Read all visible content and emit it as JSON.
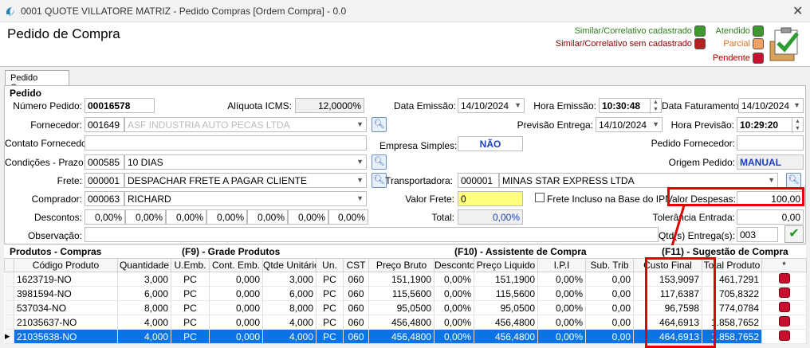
{
  "window": {
    "title": "0001 QUOTE VILLATORE MATRIZ - Pedido Compras [Ordem Compra] - 0.0"
  },
  "page_title": "Pedido de Compra",
  "legend": {
    "similar_cad": "Similar/Correlativo cadastrado",
    "similar_sem": "Similar/Correlativo sem cadastrado",
    "atendido": "Atendido",
    "parcial": "Parcial",
    "pendente": "Pendente",
    "colors": {
      "green": "#3c9a2c",
      "dark_red": "#b22222",
      "orange": "#f0a060",
      "red": "#c8102e"
    }
  },
  "tab": "Pedido Compra",
  "section": "Pedido",
  "form": {
    "numero_label": "Número Pedido:",
    "numero": "00016578",
    "aliquota_label": "Alíquota ICMS:",
    "aliquota": "12,0000%",
    "data_emissao_label": "Data Emissão:",
    "data_emissao": "14/10/2024",
    "hora_emissao_label": "Hora Emissão:",
    "hora_emissao": "10:30:48",
    "data_fat_label": "Data Faturamento:",
    "data_fat": "14/10/2024",
    "fornecedor_label": "Fornecedor:",
    "fornecedor_cod": "001649",
    "fornecedor_nome": "ASF INDUSTRIA AUTO PECAS LTDA",
    "previsao_label": "Previsão Entrega:",
    "previsao": "14/10/2024",
    "hora_prev_label": "Hora Previsão:",
    "hora_prev": "10:29:20",
    "contato_label": "Contato Fornecedor:",
    "empresa_simples_label": "Empresa Simples:",
    "empresa_simples": "NÃO",
    "pedido_forn_label": "Pedido Fornecedor:",
    "cond_label": "Condições - Prazo:",
    "cond_cod": "000585",
    "cond": "10 DIAS",
    "origem_label": "Origem Pedido:",
    "origem": "MANUAL",
    "frete_label": "Frete:",
    "frete_cod": "000001",
    "frete": "DESPACHAR FRETE A PAGAR CLIENTE",
    "transp_label": "Transportadora:",
    "transp_cod": "000001",
    "transp": "MINAS STAR EXPRESS LTDA",
    "comprador_label": "Comprador:",
    "comprador_cod": "000063",
    "comprador": "RICHARD",
    "valor_frete_label": "Valor Frete:",
    "valor_frete": "0",
    "frete_incluso_label": "Frete Incluso na Base do IPI",
    "valor_desp_label": "Valor Despesas:",
    "valor_desp": "100,00",
    "descontos_label": "Descontos:",
    "descontos": [
      "0,00%",
      "0,00%",
      "0,00%",
      "0,00%",
      "0,00%",
      "0,00%",
      "0,00%"
    ],
    "total_label": "Total:",
    "total": "0,00%",
    "tolerancia_label": "Tolerância Entrada:",
    "tolerancia": "0,00",
    "obs_label": "Observação:",
    "qtd_entregas_label": "Qtd(s) Entrega(s):",
    "qtd_entregas": "003"
  },
  "grid_sections": {
    "left": "Produtos - Compras",
    "f9": "(F9) - Grade Produtos",
    "f10": "(F10) - Assistente de Compra",
    "f11": "(F11) - Sugestão de Compra"
  },
  "columns": [
    "Código Produto",
    "Quantidade",
    "U.Emb.",
    "Cont. Emb.",
    "Qtde Unitário",
    "Un.",
    "CST",
    "Preço Bruto",
    "Desconto",
    "Preço Liquido",
    "I.P.I",
    "Sub. Trib",
    "Custo Final",
    "Total Produto",
    "*"
  ],
  "rows": [
    [
      "1623719-NO",
      "3,000",
      "PC",
      "0,000",
      "3,000",
      "PC",
      "060",
      "151,1900",
      "0,00%",
      "151,1900",
      "0,00%",
      "0,00",
      "153,9097",
      "461,7291"
    ],
    [
      "3981594-NO",
      "6,000",
      "PC",
      "0,000",
      "6,000",
      "PC",
      "060",
      "115,5600",
      "0,00%",
      "115,5600",
      "0,00%",
      "0,00",
      "117,6387",
      "705,8322"
    ],
    [
      "537034-NO",
      "8,000",
      "PC",
      "0,000",
      "8,000",
      "PC",
      "060",
      "95,0500",
      "0,00%",
      "95,0500",
      "0,00%",
      "0,00",
      "96,7598",
      "774,0784"
    ],
    [
      "21035637-NO",
      "4,000",
      "PC",
      "0,000",
      "4,000",
      "PC",
      "060",
      "456,4800",
      "0,00%",
      "456,4800",
      "0,00%",
      "0,00",
      "464,6913",
      "1.858,7652"
    ],
    [
      "21035638-NO",
      "4,000",
      "PC",
      "0,000",
      "4,000",
      "PC",
      "060",
      "456,4800",
      "0,00%",
      "456,4800",
      "0,00%",
      "0,00",
      "464,6913",
      "1.858,7652"
    ]
  ]
}
